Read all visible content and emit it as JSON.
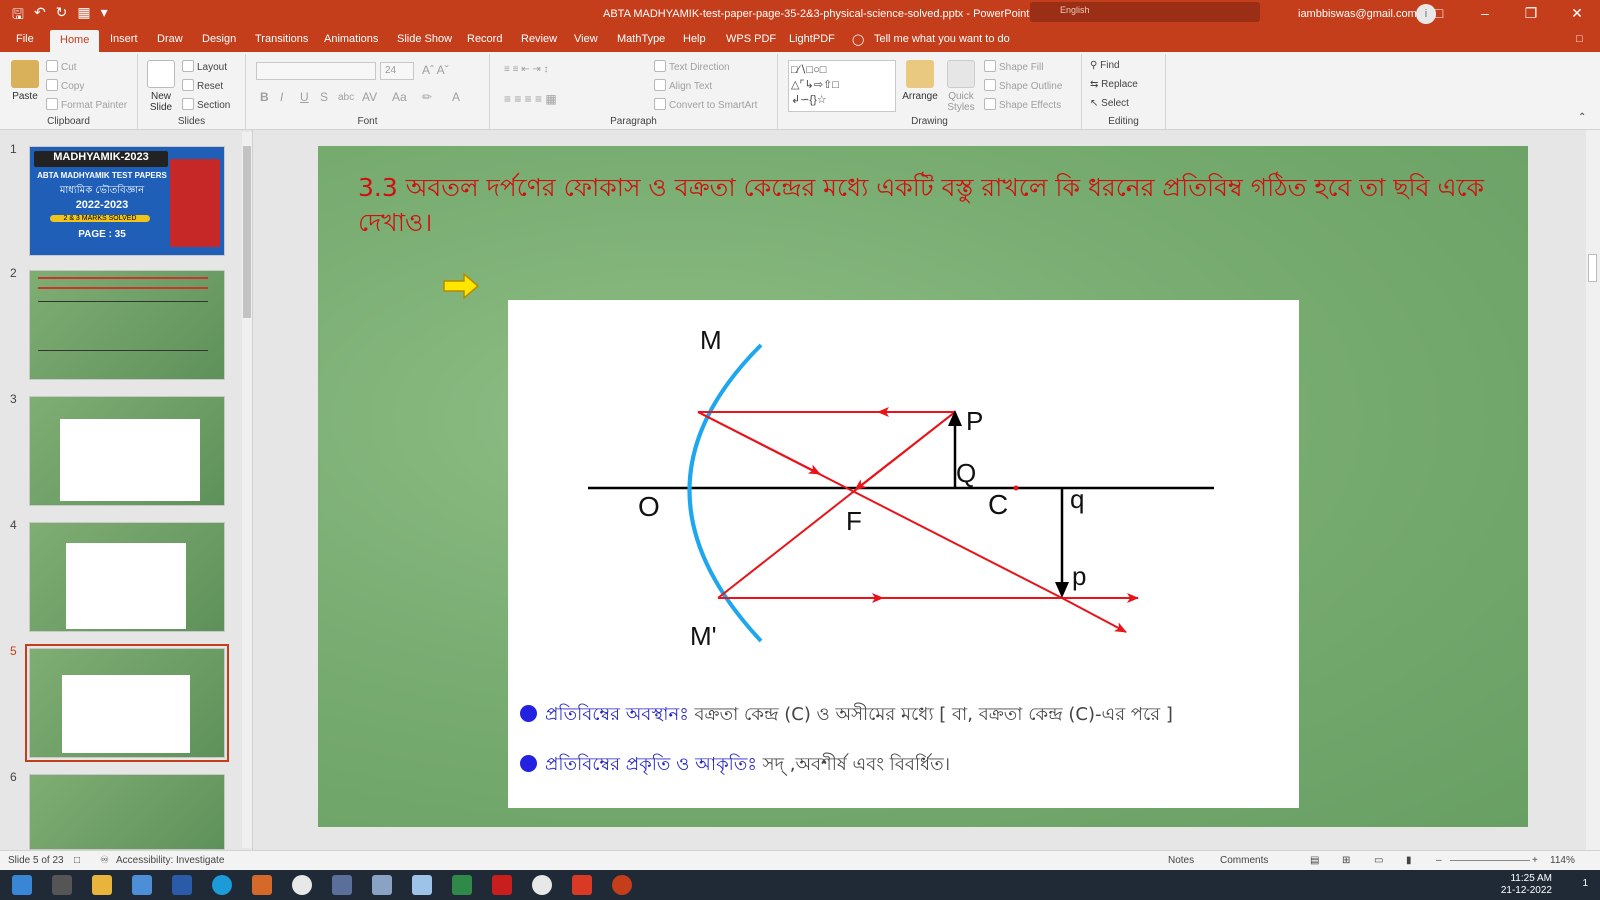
{
  "window": {
    "title": "ABTA MADHYAMIK-test-paper-page-35-2&3-physical-science-solved.pptx  -  PowerPoint",
    "language": "English",
    "account": "iambbiswas@gmail.com",
    "avatar_initial": "i"
  },
  "tabs": [
    "File",
    "Home",
    "Insert",
    "Draw",
    "Design",
    "Transitions",
    "Animations",
    "Slide Show",
    "Record",
    "Review",
    "View",
    "MathType",
    "Help",
    "WPS PDF",
    "LightPDF"
  ],
  "active_tab": "Home",
  "tell_me": "Tell me what you want to do",
  "ribbon": {
    "clipboard": {
      "label": "Clipboard",
      "paste": "Paste",
      "cut": "Cut",
      "copy": "Copy",
      "format_painter": "Format Painter"
    },
    "slides": {
      "label": "Slides",
      "new_slide": "New Slide",
      "layout": "Layout",
      "reset": "Reset",
      "section": "Section"
    },
    "font": {
      "label": "Font",
      "size": "24"
    },
    "paragraph": {
      "label": "Paragraph",
      "text_direction": "Text Direction",
      "align_text": "Align Text",
      "convert_smartart": "Convert to SmartArt"
    },
    "drawing": {
      "label": "Drawing",
      "arrange": "Arrange",
      "quick_styles": "Quick Styles",
      "shape_fill": "Shape Fill",
      "shape_outline": "Shape Outline",
      "shape_effects": "Shape Effects"
    },
    "editing": {
      "label": "Editing",
      "find": "Find",
      "replace": "Replace",
      "select": "Select"
    }
  },
  "thumbnails": [
    {
      "num": "1",
      "title": "MADHYAMIK-2023",
      "sub": "ABTA MADHYAMIK TEST PAPERS",
      "bn": "মাধ্যমিক ভৌতবিজ্ঞান",
      "year": "2022-2023",
      "marks": "2 & 3 MARKS SOLVED",
      "page": "PAGE : 35"
    },
    {
      "num": "2"
    },
    {
      "num": "3"
    },
    {
      "num": "4"
    },
    {
      "num": "5"
    },
    {
      "num": "6"
    }
  ],
  "slide": {
    "title": "3.3 অবতল দর্পণের ফোকাস ও বক্রতা কেন্দ্রের মধ্যে একটি বস্তু রাখলে কি ধরনের প্রতিবিম্ব গঠিত হবে তা ছবি একে দেখাও।",
    "diagram_labels": {
      "M": "M",
      "M_prime": "M'",
      "O": "O",
      "F": "F",
      "C": "C",
      "P": "P",
      "Q": "Q",
      "p": "p",
      "q": "q"
    },
    "bullets": [
      {
        "label": "প্রতিবিম্বের অবস্থানঃ",
        "text": " বক্রতা কেন্দ্র (C) ও অসীমের মধ্যে [ বা, বক্রতা কেন্দ্র (C)-এর পরে ]"
      },
      {
        "label": "প্রতিবিম্বের প্রকৃতি ও আকৃতিঃ",
        "text": " সদ্ ,অবশীর্ষ এবং বিবর্ধিত।"
      }
    ]
  },
  "status": {
    "slide_info": "Slide 5 of 23",
    "accessibility": "Accessibility: Investigate",
    "notes": "Notes",
    "comments": "Comments",
    "zoom": "114%"
  },
  "taskbar": {
    "time": "11:25 AM",
    "date": "21-12-2022",
    "notif": "1"
  },
  "colors": {
    "accent": "#c43e1c",
    "slide_title": "#d10f0f",
    "ray": "#e8141a",
    "mirror": "#1ea7ee",
    "bullet": "#2222e0"
  }
}
